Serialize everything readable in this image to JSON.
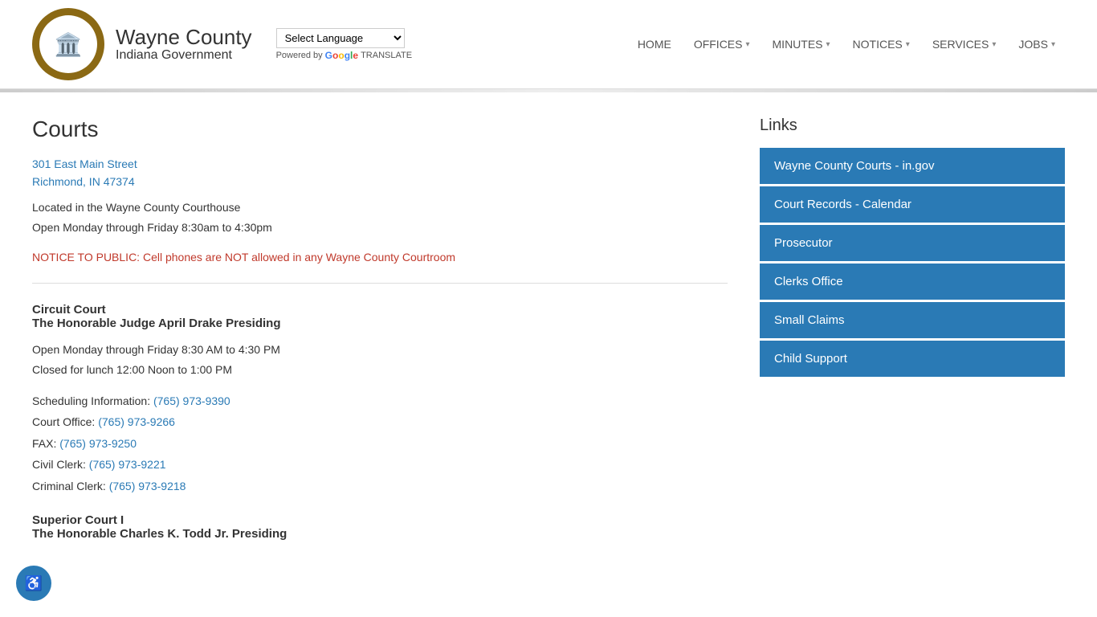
{
  "header": {
    "site_title_main": "Wayne County",
    "site_title_sub": "Indiana Government",
    "translate_label": "Select Language",
    "powered_by_text": "Powered by",
    "translate_brand": "TRANSLATE",
    "nav": [
      {
        "label": "HOME",
        "has_arrow": false
      },
      {
        "label": "OFFICES",
        "has_arrow": true
      },
      {
        "label": "MINUTES",
        "has_arrow": true
      },
      {
        "label": "NOTICES",
        "has_arrow": true
      },
      {
        "label": "SERVICES",
        "has_arrow": true
      },
      {
        "label": "JOBS",
        "has_arrow": true
      }
    ]
  },
  "page": {
    "title": "Courts",
    "address_line1": "301 East Main Street",
    "address_line2": "Richmond, IN 47374",
    "location_text": "Located in the Wayne County Courthouse",
    "hours_text": "Open Monday through Friday 8:30am to 4:30pm",
    "notice": "NOTICE TO PUBLIC: Cell phones are NOT allowed in any Wayne County Courtroom"
  },
  "circuit_court": {
    "name": "Circuit Court",
    "judge": "The Honorable Judge April Drake Presiding",
    "hours_line1": "Open Monday through Friday 8:30 AM to 4:30 PM",
    "hours_line2": "Closed for lunch 12:00 Noon to 1:00 PM",
    "scheduling_label": "Scheduling Information:",
    "scheduling_phone": "(765) 973-9390",
    "office_label": "Court Office:",
    "office_phone": "(765) 973-9266",
    "fax_label": "FAX:",
    "fax_phone": "(765) 973-9250",
    "civil_label": "Civil Clerk:",
    "civil_phone": "(765) 973-9221",
    "criminal_label": "Criminal Clerk:",
    "criminal_phone": "(765) 973-9218"
  },
  "superior_court": {
    "name": "Superior Court I",
    "judge": "The Honorable Charles K. Todd Jr. Presiding"
  },
  "sidebar": {
    "links_title": "Links",
    "links": [
      {
        "label": "Wayne County Courts - in.gov"
      },
      {
        "label": "Court Records - Calendar"
      },
      {
        "label": "Prosecutor"
      },
      {
        "label": "Clerks Office"
      },
      {
        "label": "Small Claims"
      },
      {
        "label": "Child Support"
      }
    ]
  },
  "accessibility": {
    "icon": "♿"
  }
}
